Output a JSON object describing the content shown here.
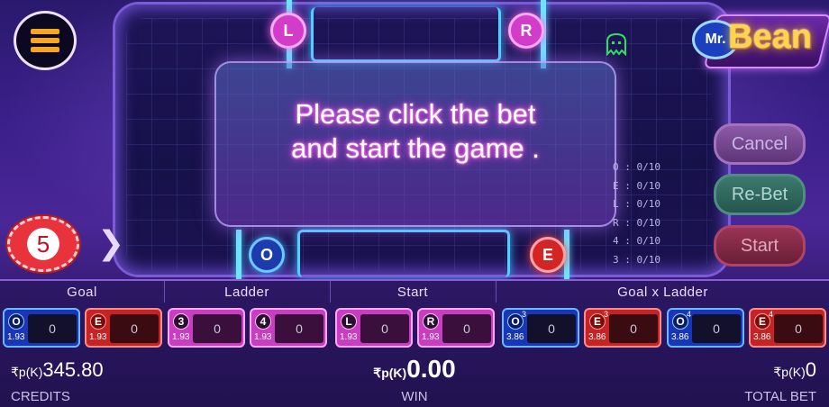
{
  "message": {
    "line1": "Please click the bet",
    "line2": "and start the game ."
  },
  "board": {
    "nodes": {
      "top_left": "L",
      "top_right": "R",
      "bottom_left": "O",
      "bottom_right": "E"
    },
    "stats": [
      "O : 0/10",
      "E : 0/10",
      "L : 0/10",
      "R : 0/10",
      "4 : 0/10",
      "3 : 0/10"
    ]
  },
  "logo": {
    "mr": "Mr.",
    "bean": "Bean"
  },
  "buttons": {
    "cancel": "Cancel",
    "rebet": "Re-Bet",
    "start": "Start"
  },
  "chip": {
    "value": "5"
  },
  "groups": {
    "goal": "Goal",
    "ladder": "Ladder",
    "start": "Start",
    "goal_x_ladder": "Goal x Ladder"
  },
  "bets": [
    {
      "badge": "O",
      "sup": "",
      "odds": "1.93",
      "amount": "0",
      "kind": "o"
    },
    {
      "badge": "E",
      "sup": "",
      "odds": "1.93",
      "amount": "0",
      "kind": "e"
    },
    {
      "badge": "3",
      "sup": "",
      "odds": "1.93",
      "amount": "0",
      "kind": "n"
    },
    {
      "badge": "4",
      "sup": "",
      "odds": "1.93",
      "amount": "0",
      "kind": "n"
    },
    {
      "badge": "L",
      "sup": "",
      "odds": "1.93",
      "amount": "0",
      "kind": "n"
    },
    {
      "badge": "R",
      "sup": "",
      "odds": "1.93",
      "amount": "0",
      "kind": "n"
    },
    {
      "badge": "O",
      "sup": "3",
      "odds": "3.86",
      "amount": "0",
      "kind": "o"
    },
    {
      "badge": "E",
      "sup": "3",
      "odds": "3.86",
      "amount": "0",
      "kind": "e"
    },
    {
      "badge": "O",
      "sup": "4",
      "odds": "3.86",
      "amount": "0",
      "kind": "o"
    },
    {
      "badge": "E",
      "sup": "4",
      "odds": "3.86",
      "amount": "0",
      "kind": "e"
    }
  ],
  "footer": {
    "currency": "₹p(K)",
    "credits_value": "345.80",
    "credits_label": "CREDITS",
    "win_value": "0.00",
    "win_label": "WIN",
    "total_bet_value": "0",
    "total_bet_label": "TOTAL BET"
  }
}
